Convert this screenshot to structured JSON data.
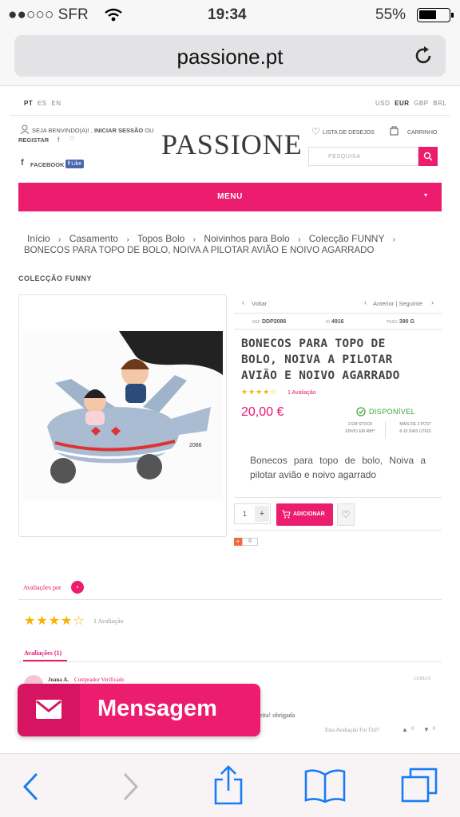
{
  "status": {
    "carrier": "●●○○○ SFR",
    "time": "19:34",
    "battery": "55%"
  },
  "browser": {
    "url": "passione.pt"
  },
  "site": {
    "languages": [
      "PT",
      "ES",
      "EN"
    ],
    "currencies": [
      "USD",
      "EUR",
      "GBP",
      "BRL"
    ],
    "welcome": "SEJA BENVINDO(A)!",
    "login": "INICIAR SESSÃO",
    "or": "OU",
    "register": "REGISTAR",
    "facebook": "FACEBOOK",
    "like": "Like",
    "logo": "PASSIONE",
    "wishlist": "LISTA DE DESEJOS",
    "cart": "CARRINHO",
    "search_placeholder": "PESQUISA",
    "menu": "MENU",
    "brand_color": "#ec1c6e"
  },
  "breadcrumb": {
    "items": [
      "Início",
      "Casamento",
      "Topos Bolo",
      "Noivinhos para Bolo",
      "Colecção FUNNY"
    ],
    "current": "BONECOS PARA TOPO DE BOLO, NOIVA A PILOTAR AVIÃO E NOIVO AGARRADO"
  },
  "collection_title": "COLECÇÃO FUNNY",
  "product": {
    "back": "Voltar",
    "prev_next": "Anterior | Seguinte",
    "ref_label": "REF",
    "ref": "DDP2086",
    "id_label": "ID",
    "id": "4916",
    "weight_label": "PESO",
    "weight": "390 G",
    "name": "BONECOS PARA TOPO DE BOLO, NOIVA A PILOTAR AVIÃO E NOIVO AGARRADO",
    "rating": 4,
    "reviews_link": "1 Avaliação",
    "price": "20,00 €",
    "availability": "DISPONÍVEL",
    "stock_line1": "2 EM STOCK",
    "stock_line2": "ENVIO EM 48H*",
    "more_line1": "MAIS DE 2 PCS?",
    "more_line2": "8-10 DIAS ÚTEIS",
    "description": "Bonecos para topo de bolo, Noiva a pilotar avião e noivo agarrado",
    "quantity": "1",
    "add_button": "ADICIONAR",
    "image_code": "2086",
    "share_count": "0"
  },
  "reviews": {
    "title": "Avaliações por",
    "rating": 4,
    "count_text": "1 Avaliação",
    "tab": "Avaliações (1)",
    "author": "Joana A.",
    "verified": "Comprador Verificado",
    "date": "11/03/15",
    "body_visible": "eita! obrigada",
    "helpful": "Esta Avaliação Foi Útil?",
    "up": "0",
    "down": "0"
  },
  "chat": {
    "label": "Mensagem"
  }
}
